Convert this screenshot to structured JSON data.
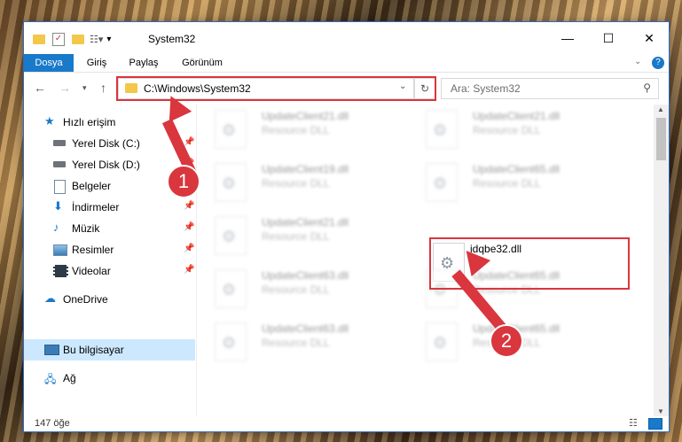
{
  "window": {
    "title": "System32",
    "minimize": "—",
    "maximize": "☐",
    "close": "✕"
  },
  "ribbon": {
    "tabs": [
      {
        "label": "Dosya",
        "active": true
      },
      {
        "label": "Giriş"
      },
      {
        "label": "Paylaş"
      },
      {
        "label": "Görünüm"
      }
    ],
    "expand_icon": "chevron-down-icon",
    "help_icon": "help-icon"
  },
  "address": {
    "path": "C:\\Windows\\System32",
    "search_placeholder": "Ara: System32"
  },
  "sidebar": {
    "items": [
      {
        "label": "Hızlı erişim",
        "icon": "star-icon",
        "pinned": false
      },
      {
        "label": "Yerel Disk (C:)",
        "icon": "drive-icon",
        "pinned": true
      },
      {
        "label": "Yerel Disk (D:)",
        "icon": "drive-icon",
        "pinned": true
      },
      {
        "label": "Belgeler",
        "icon": "documents-icon",
        "pinned": true
      },
      {
        "label": "İndirmeler",
        "icon": "download-icon",
        "pinned": true
      },
      {
        "label": "Müzik",
        "icon": "music-icon",
        "pinned": true
      },
      {
        "label": "Resimler",
        "icon": "pictures-icon",
        "pinned": true
      },
      {
        "label": "Videolar",
        "icon": "video-icon",
        "pinned": true
      },
      {
        "label": "OneDrive",
        "icon": "cloud-icon",
        "pinned": false
      },
      {
        "label": "Bu bilgisayar",
        "icon": "computer-icon",
        "pinned": false,
        "selected": true
      },
      {
        "label": "Ağ",
        "icon": "network-icon",
        "pinned": false
      }
    ]
  },
  "files": [
    {
      "name": "UpdateClient21.dll",
      "desc": "Resource DLL"
    },
    {
      "name": "UpdateClient21.dll",
      "desc": "Resource DLL"
    },
    {
      "name": "UpdateClient19.dll",
      "desc": "Resource DLL"
    },
    {
      "name": "UpdateClient65.dll",
      "desc": "Resource DLL"
    },
    {
      "name": "UpdateClient21.dll",
      "desc": "Resource DLL"
    },
    {
      "name": "idqbe32.dll",
      "desc": ""
    },
    {
      "name": "UpdateClient63.dll",
      "desc": "Resource DLL"
    },
    {
      "name": "UpdateClient65.dll",
      "desc": "Resource DLL"
    },
    {
      "name": "UpdateClient63.dll",
      "desc": "Resource DLL"
    },
    {
      "name": "UpdateClient65.dll",
      "desc": "Resource DLL"
    }
  ],
  "status": {
    "count": "147 öğe"
  },
  "annotations": {
    "badge1": "1",
    "badge2": "2"
  },
  "colors": {
    "accent": "#1979ca",
    "highlight": "#d9363e",
    "selected_bg": "#cce8ff"
  }
}
